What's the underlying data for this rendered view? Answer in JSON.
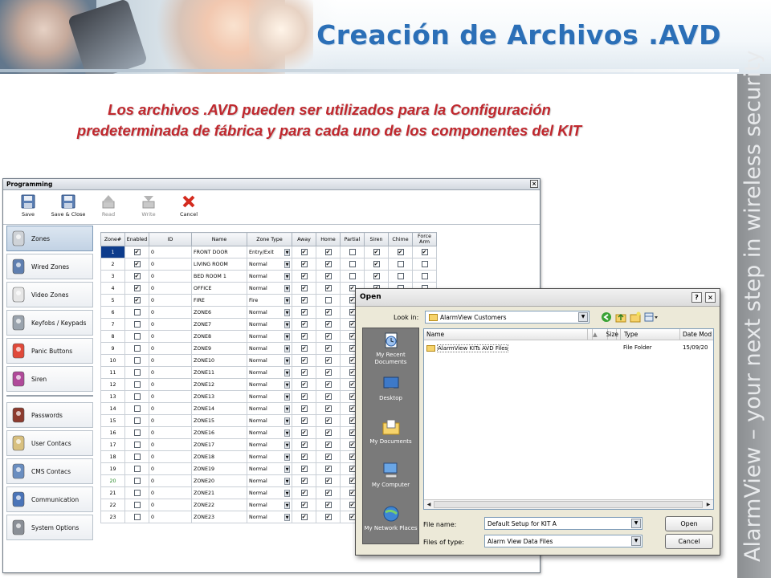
{
  "slide": {
    "title": "Creación de Archivos .AVD",
    "intro": "Los archivos .AVD pueden ser utilizados para la Configuración predeterminada de fábrica y para cada uno de los componentes del KIT",
    "side_text": "AlarmView – your next step in wireless security"
  },
  "programming": {
    "window_title": "Programming",
    "close": "×",
    "toolbar": [
      {
        "label": "Save",
        "icon": "save-icon",
        "enabled": true
      },
      {
        "label": "Save & Close",
        "icon": "save-close-icon",
        "enabled": true
      },
      {
        "label": "Read",
        "icon": "read-icon",
        "enabled": false
      },
      {
        "label": "Write",
        "icon": "write-icon",
        "enabled": false
      },
      {
        "label": "Cancel",
        "icon": "cancel-icon",
        "enabled": true
      }
    ],
    "nav_top": [
      {
        "label": "Zones",
        "icon": "zones-icon",
        "active": true
      },
      {
        "label": "Wired Zones",
        "icon": "wired-zones-icon",
        "active": false
      },
      {
        "label": "Video Zones",
        "icon": "video-zones-icon",
        "active": false
      },
      {
        "label": "Keyfobs / Keypads",
        "icon": "keyfob-icon",
        "active": false
      },
      {
        "label": "Panic Buttons",
        "icon": "panic-button-icon",
        "active": false
      },
      {
        "label": "Siren",
        "icon": "siren-icon",
        "active": false
      }
    ],
    "nav_bottom": [
      {
        "label": "Passwords",
        "icon": "password-icon"
      },
      {
        "label": "User Contacs",
        "icon": "user-contacts-icon"
      },
      {
        "label": "CMS Contacs",
        "icon": "cms-contacts-icon"
      },
      {
        "label": "Communication",
        "icon": "communication-icon"
      },
      {
        "label": "System Options",
        "icon": "system-options-icon"
      }
    ],
    "columns": [
      "Zone#",
      "Enabled",
      "ID",
      "Name",
      "Zone Type",
      "Away",
      "Home",
      "Partial",
      "Siren",
      "Chime",
      "Force Arm"
    ],
    "rows": [
      {
        "zone": "1",
        "en": true,
        "id": "0",
        "name": "FRONT DOOR",
        "type": "Entry/Exit",
        "ck": [
          true,
          true,
          false,
          true,
          true,
          true
        ]
      },
      {
        "zone": "2",
        "en": true,
        "id": "0",
        "name": "LIVING ROOM",
        "type": "Normal",
        "ck": [
          true,
          true,
          false,
          true,
          false,
          false
        ]
      },
      {
        "zone": "3",
        "en": true,
        "id": "0",
        "name": "BED ROOM 1",
        "type": "Normal",
        "ck": [
          true,
          true,
          false,
          true,
          false,
          false
        ]
      },
      {
        "zone": "4",
        "en": true,
        "id": "0",
        "name": "OFFICE",
        "type": "Normal",
        "ck": [
          true,
          true,
          true,
          true,
          false,
          false
        ]
      },
      {
        "zone": "5",
        "en": true,
        "id": "0",
        "name": "FIRE",
        "type": "Fire",
        "ck": [
          true,
          false,
          true,
          true,
          false,
          false
        ]
      },
      {
        "zone": "6",
        "en": false,
        "id": "0",
        "name": "ZONE6",
        "type": "Normal",
        "ck": [
          true,
          true,
          true,
          true,
          false,
          false
        ]
      },
      {
        "zone": "7",
        "en": false,
        "id": "0",
        "name": "ZONE7",
        "type": "Normal",
        "ck": [
          true,
          true,
          true,
          true,
          false,
          false
        ]
      },
      {
        "zone": "8",
        "en": false,
        "id": "0",
        "name": "ZONE8",
        "type": "Normal",
        "ck": [
          true,
          true,
          true,
          true,
          false,
          false
        ]
      },
      {
        "zone": "9",
        "en": false,
        "id": "0",
        "name": "ZONE9",
        "type": "Normal",
        "ck": [
          true,
          true,
          true,
          true,
          false,
          false
        ]
      },
      {
        "zone": "10",
        "en": false,
        "id": "0",
        "name": "ZONE10",
        "type": "Normal",
        "ck": [
          true,
          true,
          true,
          true,
          false,
          false
        ]
      },
      {
        "zone": "11",
        "en": false,
        "id": "0",
        "name": "ZONE11",
        "type": "Normal",
        "ck": [
          true,
          true,
          true,
          true,
          false,
          false
        ]
      },
      {
        "zone": "12",
        "en": false,
        "id": "0",
        "name": "ZONE12",
        "type": "Normal",
        "ck": [
          true,
          true,
          true,
          true,
          false,
          false
        ]
      },
      {
        "zone": "13",
        "en": false,
        "id": "0",
        "name": "ZONE13",
        "type": "Normal",
        "ck": [
          true,
          true,
          true,
          true,
          false,
          false
        ]
      },
      {
        "zone": "14",
        "en": false,
        "id": "0",
        "name": "ZONE14",
        "type": "Normal",
        "ck": [
          true,
          true,
          true,
          true,
          false,
          false
        ]
      },
      {
        "zone": "15",
        "en": false,
        "id": "0",
        "name": "ZONE15",
        "type": "Normal",
        "ck": [
          true,
          true,
          true,
          true,
          false,
          false
        ]
      },
      {
        "zone": "16",
        "en": false,
        "id": "0",
        "name": "ZONE16",
        "type": "Normal",
        "ck": [
          true,
          true,
          true,
          true,
          false,
          false
        ]
      },
      {
        "zone": "17",
        "en": false,
        "id": "0",
        "name": "ZONE17",
        "type": "Normal",
        "ck": [
          true,
          true,
          true,
          true,
          false,
          false
        ]
      },
      {
        "zone": "18",
        "en": false,
        "id": "0",
        "name": "ZONE18",
        "type": "Normal",
        "ck": [
          true,
          true,
          true,
          true,
          false,
          false
        ]
      },
      {
        "zone": "19",
        "en": false,
        "id": "0",
        "name": "ZONE19",
        "type": "Normal",
        "ck": [
          true,
          true,
          true,
          true,
          false,
          false
        ]
      },
      {
        "zone": "20",
        "en": false,
        "id": "0",
        "name": "ZONE20",
        "type": "Normal",
        "ck": [
          true,
          true,
          true,
          true,
          false,
          false
        ]
      },
      {
        "zone": "21",
        "en": false,
        "id": "0",
        "name": "ZONE21",
        "type": "Normal",
        "ck": [
          true,
          true,
          true,
          true,
          false,
          false
        ]
      },
      {
        "zone": "22",
        "en": false,
        "id": "0",
        "name": "ZONE22",
        "type": "Normal",
        "ck": [
          true,
          true,
          true,
          true,
          false,
          false
        ]
      },
      {
        "zone": "23",
        "en": false,
        "id": "0",
        "name": "ZONE23",
        "type": "Normal",
        "ck": [
          true,
          true,
          true,
          true,
          false,
          false
        ]
      }
    ]
  },
  "open_dialog": {
    "title": "Open",
    "help": "?",
    "close": "×",
    "look_in_label": "Look in:",
    "look_in_value": "AlarmView Customers",
    "places": [
      {
        "label": "My Recent Documents",
        "icon": "recent-documents-icon"
      },
      {
        "label": "Desktop",
        "icon": "desktop-icon"
      },
      {
        "label": "My Documents",
        "icon": "my-documents-icon"
      },
      {
        "label": "My Computer",
        "icon": "my-computer-icon"
      },
      {
        "label": "My Network Places",
        "icon": "network-places-icon"
      }
    ],
    "headers": [
      "Name",
      "Size",
      "Type",
      "Date Mod"
    ],
    "files": [
      {
        "name": "AlarmView KITs AVD Files",
        "size": "",
        "type": "File Folder",
        "date": "15/09/20"
      }
    ],
    "file_name_label": "File name:",
    "file_name_value": "Default Setup for KIT A",
    "files_of_type_label": "Files of type:",
    "files_of_type_value": "Alarm View Data Files",
    "open_button": "Open",
    "cancel_button": "Cancel"
  },
  "colors": {
    "title": "#2b6fb7",
    "intro": "#c0282e",
    "selected_row": "#0d3c8c",
    "side_band": "#9a9da0"
  }
}
